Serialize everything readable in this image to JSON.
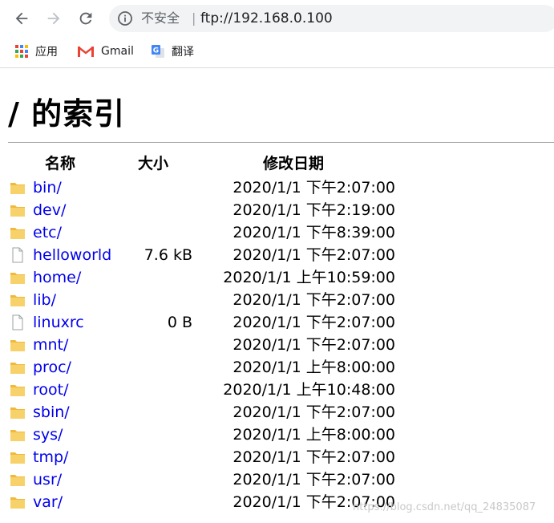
{
  "browser": {
    "security_label": "不安全",
    "separator": "|",
    "url": "ftp://192.168.0.100"
  },
  "bookmarks": [
    {
      "label": "应用",
      "icon": "apps-grid-icon"
    },
    {
      "label": "Gmail",
      "icon": "gmail-icon"
    },
    {
      "label": "翻译",
      "icon": "google-translate-icon"
    }
  ],
  "page": {
    "title": "/ 的索引",
    "columns": {
      "name": "名称",
      "size": "大小",
      "modified": "修改日期"
    },
    "rows": [
      {
        "name": "bin/",
        "type": "folder",
        "size": "",
        "modified": "2020/1/1 下午2:07:00"
      },
      {
        "name": "dev/",
        "type": "folder",
        "size": "",
        "modified": "2020/1/1 下午2:19:00"
      },
      {
        "name": "etc/",
        "type": "folder",
        "size": "",
        "modified": "2020/1/1 下午8:39:00"
      },
      {
        "name": "helloworld",
        "type": "file",
        "size": "7.6 kB",
        "modified": "2020/1/1 下午2:07:00"
      },
      {
        "name": "home/",
        "type": "folder",
        "size": "",
        "modified": "2020/1/1 上午10:59:00"
      },
      {
        "name": "lib/",
        "type": "folder",
        "size": "",
        "modified": "2020/1/1 下午2:07:00"
      },
      {
        "name": "linuxrc",
        "type": "file",
        "size": "0 B",
        "modified": "2020/1/1 下午2:07:00"
      },
      {
        "name": "mnt/",
        "type": "folder",
        "size": "",
        "modified": "2020/1/1 下午2:07:00"
      },
      {
        "name": "proc/",
        "type": "folder",
        "size": "",
        "modified": "2020/1/1 上午8:00:00"
      },
      {
        "name": "root/",
        "type": "folder",
        "size": "",
        "modified": "2020/1/1 上午10:48:00"
      },
      {
        "name": "sbin/",
        "type": "folder",
        "size": "",
        "modified": "2020/1/1 下午2:07:00"
      },
      {
        "name": "sys/",
        "type": "folder",
        "size": "",
        "modified": "2020/1/1 上午8:00:00"
      },
      {
        "name": "tmp/",
        "type": "folder",
        "size": "",
        "modified": "2020/1/1 下午2:07:00"
      },
      {
        "name": "usr/",
        "type": "folder",
        "size": "",
        "modified": "2020/1/1 下午2:07:00"
      },
      {
        "name": "var/",
        "type": "folder",
        "size": "",
        "modified": "2020/1/1 下午2:07:00"
      }
    ]
  },
  "watermark": "https://blog.csdn.net/qq_24835087",
  "colors": {
    "link": "#0000ee",
    "folder": "#f2c14e",
    "omnibox_bg": "#f1f3f4"
  }
}
